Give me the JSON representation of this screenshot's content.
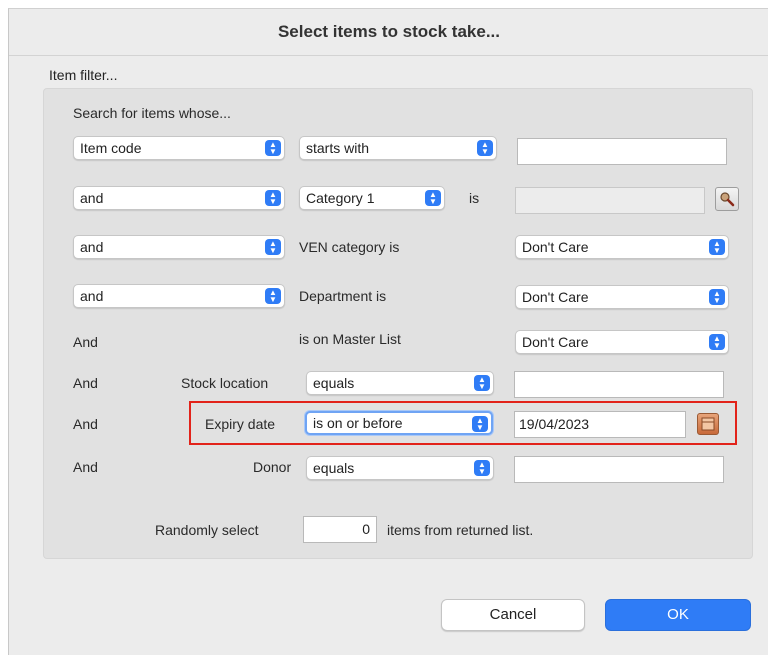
{
  "dialog": {
    "title": "Select items to stock take..."
  },
  "filter": {
    "group_label": "Item filter...",
    "intro": "Search for items whose...",
    "row1": {
      "field": "Item code",
      "operator": "starts with",
      "value": ""
    },
    "row2": {
      "conj": "and",
      "field": "Category 1",
      "is_label": "is",
      "value": ""
    },
    "row3": {
      "conj": "and",
      "label": "VEN category is",
      "value": "Don't Care"
    },
    "row4": {
      "conj": "and",
      "label": "Department is",
      "value": "Don't Care"
    },
    "row5": {
      "conj": "And",
      "label": "is on Master List",
      "value": "Don't Care"
    },
    "row6": {
      "conj": "And",
      "label": "Stock location",
      "operator": "equals",
      "value": ""
    },
    "row7": {
      "conj": "And",
      "label": "Expiry date",
      "operator": "is on or before",
      "value": "19/04/2023"
    },
    "row8": {
      "conj": "And",
      "label": "Donor",
      "operator": "equals",
      "value": ""
    },
    "random": {
      "label": "Randomly select",
      "count": "0",
      "suffix": "items from returned list."
    }
  },
  "buttons": {
    "cancel": "Cancel",
    "ok": "OK"
  },
  "icons": {
    "lookup": "magnifier-icon",
    "calendar": "calendar-icon",
    "popup": "popup-arrows-icon"
  },
  "colors": {
    "accent": "#2f7cf6",
    "highlight": "#e2231a"
  }
}
